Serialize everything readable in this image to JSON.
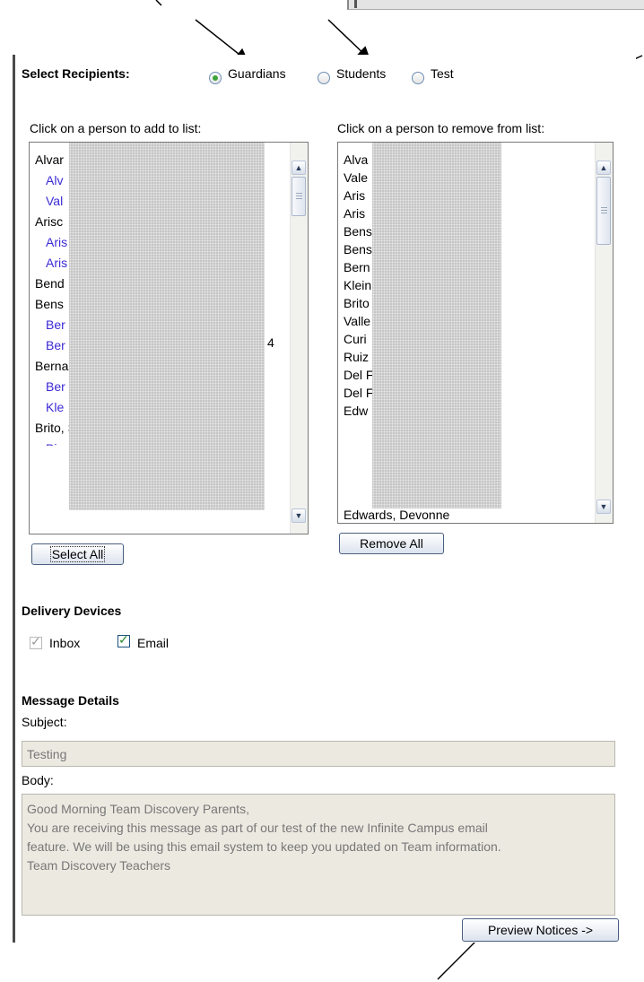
{
  "recipients": {
    "label": "Select Recipients:",
    "options": [
      {
        "label": "Guardians",
        "selected": true
      },
      {
        "label": "Students",
        "selected": false
      },
      {
        "label": "Test",
        "selected": false
      }
    ]
  },
  "add_list": {
    "heading": "Click on a person to add to list:",
    "items": [
      {
        "text": "Alvar",
        "kind": "guardian"
      },
      {
        "text": "Alv",
        "kind": "student"
      },
      {
        "text": "Val",
        "kind": "student"
      },
      {
        "text": "Arisc",
        "kind": "guardian"
      },
      {
        "text": "Aris",
        "kind": "student"
      },
      {
        "text": "Aris",
        "kind": "student"
      },
      {
        "text": "Bend",
        "kind": "guardian"
      },
      {
        "text": "Bens",
        "kind": "guardian"
      },
      {
        "text": "Ber",
        "kind": "student"
      },
      {
        "text": "Ber",
        "kind": "student"
      },
      {
        "text": "Berna",
        "kind": "guardian"
      },
      {
        "text": "Ber",
        "kind": "student"
      },
      {
        "text": "Kle",
        "kind": "student"
      },
      {
        "text": "Brito, Steven D(07) 30004337",
        "kind": "guardian"
      }
    ],
    "trailing_digit": "4",
    "select_all": "Select All"
  },
  "remove_list": {
    "heading": "Click on a person to remove from list:",
    "items": [
      "Alva",
      "Vale",
      "Aris",
      "Aris",
      "Bens",
      "Bens",
      "Bern",
      "Klein",
      "Brito",
      "Valle",
      "Curi",
      "Ruiz",
      "Del F",
      "Del F",
      "Edw",
      "Edwards, Devonne"
    ],
    "remove_all": "Remove All"
  },
  "delivery": {
    "heading": "Delivery Devices",
    "inbox": {
      "label": "Inbox",
      "checked": true,
      "disabled": true
    },
    "email": {
      "label": "Email",
      "checked": true,
      "disabled": false
    }
  },
  "message": {
    "heading": "Message Details",
    "subject_label": "Subject:",
    "subject_value": "Testing",
    "body_label": "Body:",
    "body_lines": [
      "Good Morning Team Discovery Parents,",
      "You are receiving this message as part of our test of the new Infinite Campus email",
      "feature.  We will be using this email system to keep you updated on Team information.",
      "Team Discovery Teachers"
    ],
    "preview_button": "Preview Notices ->"
  },
  "colors": {
    "student_link": "#3b2ad6",
    "radio_selected": "#3da33a",
    "email_check": "#2c8a2c"
  }
}
